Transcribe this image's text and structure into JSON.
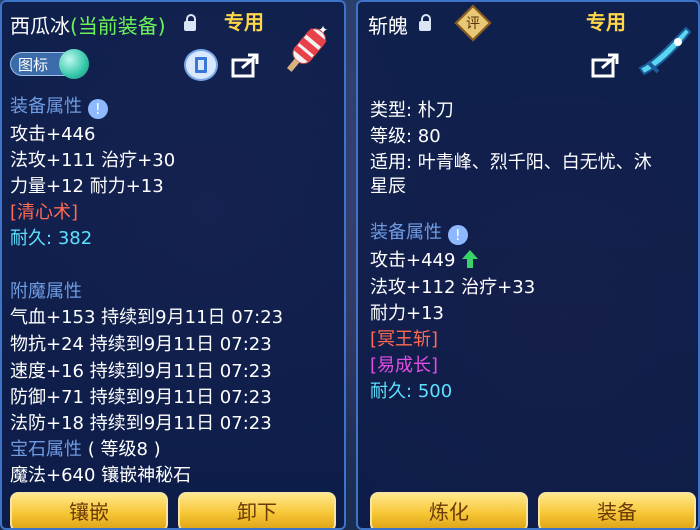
{
  "left": {
    "name": "西瓜冰",
    "status": "(当前装备)",
    "special_label": "专用",
    "icon_tag": "图标",
    "section_attr": "装备属性",
    "attack": "攻击+446",
    "magic_heal": "法攻+111 治疗+30",
    "str_end": "力量+12 耐力+13",
    "skill": "[清心术]",
    "durability_label": "耐久:",
    "durability_value": "382",
    "section_enchant": "附魔属性",
    "enchants": [
      "气血+153 持续到9月11日 07:23",
      "物抗+24 持续到9月11日 07:23",
      "速度+16 持续到9月11日 07:23",
      "防御+71 持续到9月11日 07:23",
      "法防+18 持续到9月11日 07:23"
    ],
    "gem_title": "宝石属性",
    "gem_level": "( 等级8 )",
    "gem_line": "魔法+640 镶嵌神秘石",
    "btn_embed": "镶嵌",
    "btn_unequip": "卸下"
  },
  "right": {
    "name": "斩魄",
    "badge": "评",
    "special_label": "专用",
    "type_line": "类型:  朴刀",
    "level_line": "等级:  80",
    "applies_line1": "适用:  叶青峰、烈千阳、白无忧、沐",
    "applies_line2": "星辰",
    "section_attr": "装备属性",
    "attack": "攻击+449",
    "magic_heal": "法攻+112 治疗+33",
    "endurance": "耐力+13",
    "skill1": "[冥王斩]",
    "skill2": "[易成长]",
    "durability_label": "耐久:",
    "durability_value": "500",
    "btn_refine": "炼化",
    "btn_equip": "装备"
  },
  "colors": {
    "accent_green": "#6df25a",
    "gold": "#ffd54a",
    "header_blue": "#6f9be0",
    "red": "#ff6a52",
    "purple": "#e14ee6",
    "cyan": "#5ee0ff"
  }
}
